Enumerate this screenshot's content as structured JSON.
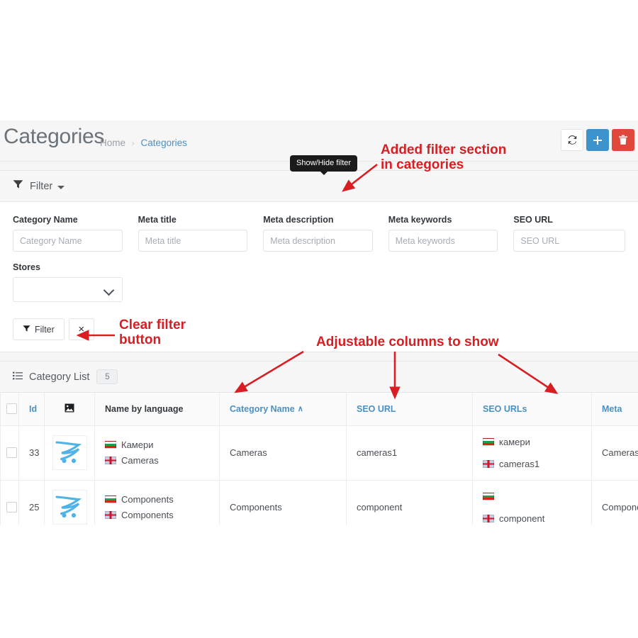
{
  "header": {
    "title": "Categories",
    "breadcrumb": {
      "home": "Home",
      "separator": "›",
      "current": "Categories"
    },
    "actions": [
      {
        "name": "refresh-button",
        "label": "Refresh",
        "color": "#ffffff"
      },
      {
        "name": "add-button",
        "label": "+",
        "color": "#3d93cd"
      },
      {
        "name": "delete-button",
        "label": "Delete",
        "color": "#e0483c"
      }
    ]
  },
  "tooltip": {
    "text": "Show/Hide filter"
  },
  "filter_panel": {
    "title": "Filter",
    "fields": [
      {
        "label": "Category Name",
        "placeholder": "Category Name",
        "value": ""
      },
      {
        "label": "Meta title",
        "placeholder": "Meta title",
        "value": ""
      },
      {
        "label": "Meta description",
        "placeholder": "Meta description",
        "value": ""
      },
      {
        "label": "Meta keywords",
        "placeholder": "Meta keywords",
        "value": ""
      },
      {
        "label": "SEO URL",
        "placeholder": "SEO URL",
        "value": ""
      }
    ],
    "stores": {
      "label": "Stores",
      "selected": "",
      "options": [
        ""
      ]
    },
    "buttons": {
      "filter": "Filter",
      "clear": "×"
    }
  },
  "list_panel": {
    "title": "Category List",
    "count": "5",
    "columns": [
      {
        "label": "",
        "name": "select-all",
        "sortable": false
      },
      {
        "label": "Id",
        "name": "id",
        "sortable": true
      },
      {
        "label": "",
        "name": "image",
        "sortable": false
      },
      {
        "label": "Name by language",
        "name": "name-by-language",
        "sortable": false
      },
      {
        "label": "Category Name",
        "name": "category-name",
        "sortable": true,
        "sort": "∧"
      },
      {
        "label": "SEO URL",
        "name": "seo-url",
        "sortable": true
      },
      {
        "label": "SEO URLs",
        "name": "seo-urls",
        "sortable": true
      },
      {
        "label": "Meta",
        "name": "meta",
        "sortable": true
      }
    ],
    "rows": [
      {
        "id": "33",
        "names": [
          {
            "flag": "bg",
            "text": "Камери"
          },
          {
            "flag": "en",
            "text": "Cameras"
          }
        ],
        "category_name": "Cameras",
        "seo_url": "cameras1",
        "seo_urls": [
          {
            "flag": "bg",
            "text": "камери"
          },
          {
            "flag": "en",
            "text": "cameras1"
          }
        ],
        "meta": "Cameras"
      },
      {
        "id": "25",
        "names": [
          {
            "flag": "bg",
            "text": "Components"
          },
          {
            "flag": "en",
            "text": "Components"
          }
        ],
        "category_name": "Components",
        "seo_url": "component",
        "seo_urls": [
          {
            "flag": "bg",
            "text": ""
          },
          {
            "flag": "en",
            "text": "component"
          }
        ],
        "meta": "Components"
      }
    ]
  },
  "annotations": {
    "color": "#d81e22",
    "items": [
      {
        "name": "annotation-filter-section",
        "text": "Added filter section\nin categories"
      },
      {
        "name": "annotation-clear-filter",
        "text": "Clear filter\nbutton"
      },
      {
        "name": "annotation-columns",
        "text": "Adjustable columns to show"
      }
    ]
  }
}
